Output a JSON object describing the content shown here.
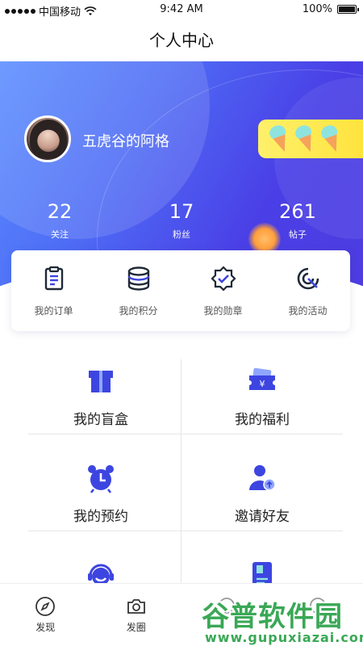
{
  "status_bar": {
    "carrier": "中国移动",
    "time": "9:42 AM",
    "battery": "100%"
  },
  "header": {
    "title": "个人中心"
  },
  "profile": {
    "name": "五虎谷的阿格",
    "badge_icon": "ice-cream-icon",
    "stats": [
      {
        "value": "22",
        "label": "关注"
      },
      {
        "value": "17",
        "label": "粉丝"
      },
      {
        "value": "261",
        "label": "帖子"
      }
    ]
  },
  "quick_actions": [
    {
      "label": "我的订单",
      "icon": "clipboard-icon"
    },
    {
      "label": "我的积分",
      "icon": "database-icon"
    },
    {
      "label": "我的勋章",
      "icon": "badge-check-icon"
    },
    {
      "label": "我的活动",
      "icon": "target-icon"
    }
  ],
  "grid": [
    {
      "label": "我的盲盒",
      "icon": "gift-box-icon"
    },
    {
      "label": "我的福利",
      "icon": "coupon-icon"
    },
    {
      "label": "我的预约",
      "icon": "alarm-clock-icon"
    },
    {
      "label": "邀请好友",
      "icon": "add-user-icon"
    },
    {
      "label": "",
      "icon": "headset-icon"
    },
    {
      "label": "",
      "icon": "book-icon"
    }
  ],
  "tabs": [
    {
      "label": "发现",
      "icon": "compass-icon"
    },
    {
      "label": "发圈",
      "icon": "camera-icon"
    },
    {
      "label": "",
      "icon": "tab-icon-3"
    },
    {
      "label": "",
      "icon": "tab-icon-4"
    }
  ],
  "watermark": {
    "text": "谷普软件园",
    "url": "www.gupuxiazai.com"
  },
  "colors": {
    "accent": "#4a3fe6",
    "icon_blue": "#3d45e0",
    "icon_dark": "#1f2937",
    "badge_yellow": "#ffe33b"
  }
}
